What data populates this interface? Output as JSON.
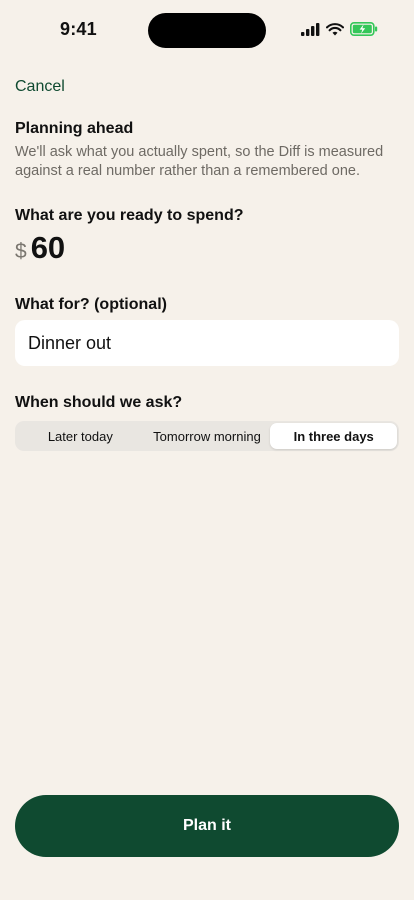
{
  "status_bar": {
    "time": "9:41",
    "icons": [
      "cellular-signal-icon",
      "wifi-icon",
      "battery-charging-icon"
    ]
  },
  "nav": {
    "cancel_label": "Cancel"
  },
  "intro": {
    "title": "Planning ahead",
    "description": "We'll ask what you actually spent, so the Diff is measured against a real number rather than a remembered one."
  },
  "amount": {
    "label": "What are you ready to spend?",
    "currency": "$",
    "value": "60"
  },
  "purpose": {
    "label": "What for? (optional)",
    "value": "Dinner out"
  },
  "timing": {
    "label": "When should we ask?",
    "options": [
      "Later today",
      "Tomorrow morning",
      "In three days"
    ],
    "selected": "In three days"
  },
  "action": {
    "label": "Plan it"
  },
  "colors": {
    "background": "#f6f1ea",
    "accent": "#0f4a30",
    "battery": "#34c759"
  }
}
